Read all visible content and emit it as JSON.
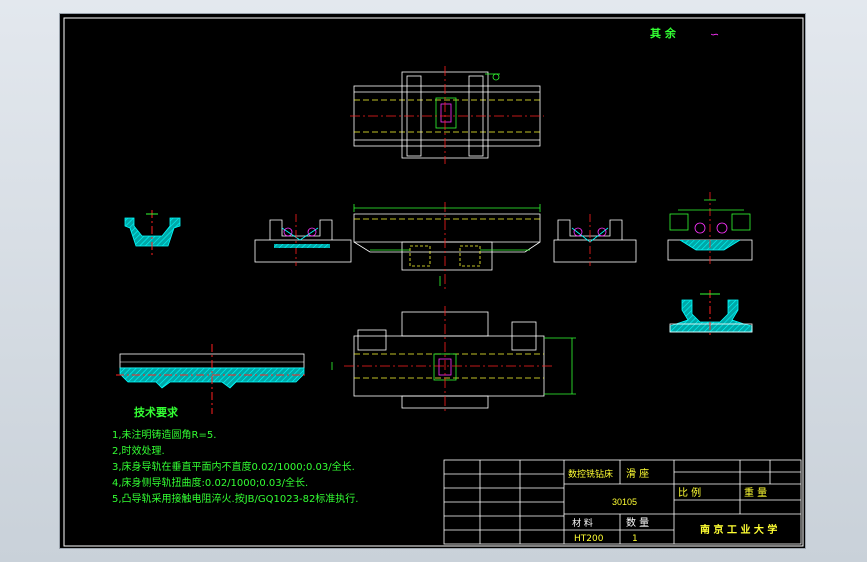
{
  "drawing": {
    "surface_note": "其 余",
    "surface_symbol": "∽",
    "tech_title": "技术要求",
    "requirements": [
      "1,未注明铸造圆角R=5.",
      "2,时效处理.",
      "3,床身导轨在垂直平面内不直度0.02/1000;0.03/全长.",
      "4,床身侧导轨扭曲度:0.02/1000;0.03/全长.",
      "5,凸导轨采用接触电阻淬火.按JB/GQ1023-82标准执行."
    ]
  },
  "title_block": {
    "part_desc": "数控铣钻床",
    "part_name": "滑 座",
    "drawing_no": "30105",
    "scale_label": "比 例",
    "weight_label": "重 量",
    "material_label": "材 料",
    "quantity_label": "数 量",
    "material_value": "HT200",
    "quantity_value": "1",
    "school": "南 京 工 业 大 学"
  },
  "colors": {
    "sheet": "#000000",
    "outline": "#ffffff",
    "dimension": "#33ff33",
    "centerline": "#ff2020",
    "section_fill": "#00c8c8",
    "hidden": "#ffff33",
    "annotation": "#ff33ff"
  }
}
